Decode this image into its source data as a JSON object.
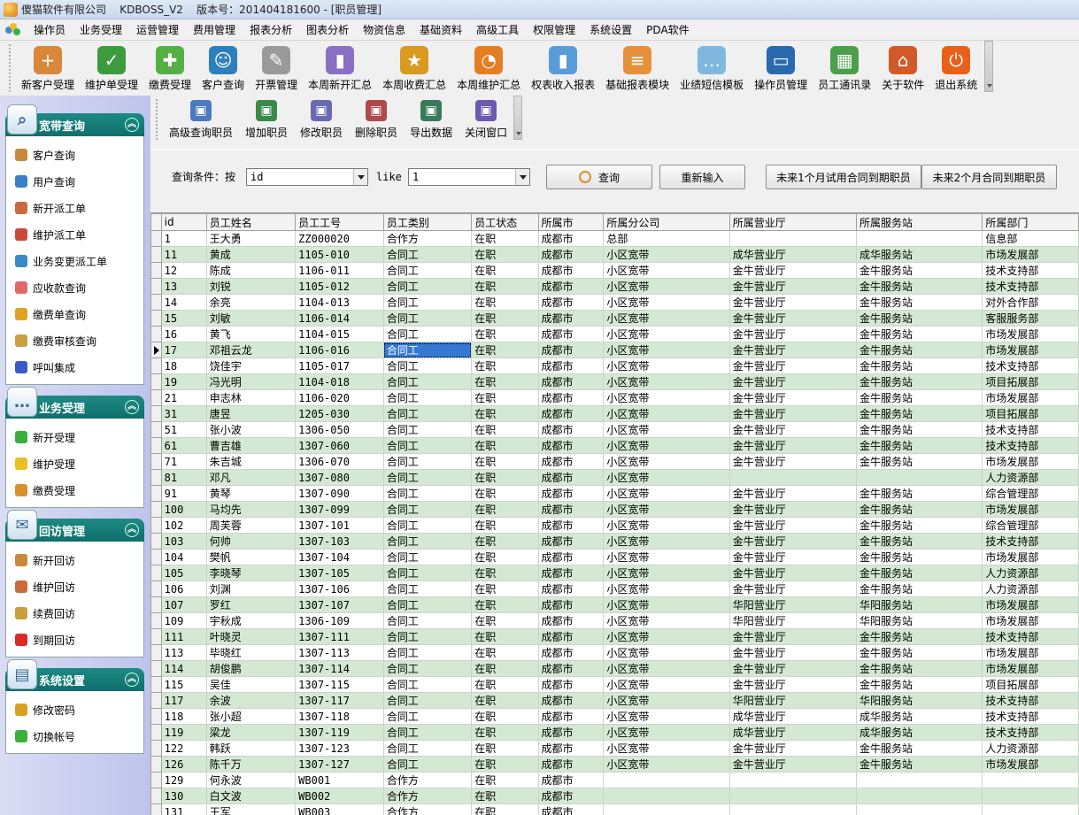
{
  "window": {
    "title": "傻猫软件有限公司    KDBOSS_V2    版本号：201404181600 - [职员管理]"
  },
  "menu": [
    "操作员",
    "业务受理",
    "运营管理",
    "费用管理",
    "报表分析",
    "图表分析",
    "物资信息",
    "基础资料",
    "高级工具",
    "权限管理",
    "系统设置",
    "PDA软件"
  ],
  "toolbar": [
    {
      "label": "新客户受理",
      "icon": "add-user-icon",
      "color": "#d9873a"
    },
    {
      "label": "维护单受理",
      "icon": "check-sheet-icon",
      "color": "#3c9b3c"
    },
    {
      "label": "缴费受理",
      "icon": "heart-plus-icon",
      "color": "#55b044"
    },
    {
      "label": "客户查询",
      "icon": "users-icon",
      "color": "#2f7fbd"
    },
    {
      "label": "开票管理",
      "icon": "invoice-icon",
      "color": "#9a9a9a"
    },
    {
      "label": "本周新开汇总",
      "icon": "bar-chart-icon",
      "color": "#8a6fc4"
    },
    {
      "label": "本周收费汇总",
      "icon": "medal-icon",
      "color": "#d99a20"
    },
    {
      "label": "本周维护汇总",
      "icon": "pie-chart-icon",
      "color": "#e57e22"
    },
    {
      "label": "权表收入报表",
      "icon": "column-chart-icon",
      "color": "#5a9cd8"
    },
    {
      "label": "基础报表模块",
      "icon": "report-chart-icon",
      "color": "#e6913a"
    },
    {
      "label": "业绩短信模板",
      "icon": "sms-icon",
      "color": "#7fb8df"
    },
    {
      "label": "操作员管理",
      "icon": "monitor-icon",
      "color": "#2869b0"
    },
    {
      "label": "员工通讯录",
      "icon": "spreadsheet-icon",
      "color": "#4aa04a"
    },
    {
      "label": "关于软件",
      "icon": "home-icon",
      "color": "#d25a2a"
    },
    {
      "label": "退出系统",
      "icon": "power-icon",
      "color": "#e8601a"
    }
  ],
  "sidebar": [
    {
      "title": "宽带查询",
      "icon": "magnifier-icon",
      "items": [
        {
          "label": "客户查询",
          "icon": "user-icon",
          "color": "#c88a3a"
        },
        {
          "label": "用户查询",
          "icon": "users-icon",
          "color": "#3a7fc8"
        },
        {
          "label": "新开派工单",
          "icon": "user-add-icon",
          "color": "#c86a3a"
        },
        {
          "label": "维护派工单",
          "icon": "user-edit-icon",
          "color": "#c84a3a"
        },
        {
          "label": "业务变更派工单",
          "icon": "user-swap-icon",
          "color": "#3a8ac8"
        },
        {
          "label": "应收款查询",
          "icon": "receivable-icon",
          "color": "#e06a6a"
        },
        {
          "label": "缴费单查询",
          "icon": "payment-icon",
          "color": "#e0a020"
        },
        {
          "label": "缴费审核查询",
          "icon": "audit-icon",
          "color": "#c8a040"
        },
        {
          "label": "呼叫集成",
          "icon": "phone-icon",
          "color": "#3a5ac8"
        }
      ]
    },
    {
      "title": "业务受理",
      "icon": "chat-icon",
      "items": [
        {
          "label": "新开受理",
          "icon": "plus-icon",
          "color": "#3ab03a"
        },
        {
          "label": "维护受理",
          "icon": "smiley-icon",
          "color": "#e8c020"
        },
        {
          "label": "缴费受理",
          "icon": "coins-icon",
          "color": "#d8902a"
        }
      ]
    },
    {
      "title": "回访管理",
      "icon": "envelope-icon",
      "items": [
        {
          "label": "新开回访",
          "icon": "user-icon",
          "color": "#c88a3a"
        },
        {
          "label": "维护回访",
          "icon": "user-edit-icon",
          "color": "#c86a3a"
        },
        {
          "label": "续费回访",
          "icon": "user-money-icon",
          "color": "#c8a03a"
        },
        {
          "label": "到期回访",
          "icon": "heart-icon",
          "color": "#d82a2a"
        }
      ]
    },
    {
      "title": "系统设置",
      "icon": "window-icon",
      "items": [
        {
          "label": "修改密码",
          "icon": "lock-icon",
          "color": "#d8a020"
        },
        {
          "label": "切换帐号",
          "icon": "switch-icon",
          "color": "#3ab03a"
        }
      ]
    }
  ],
  "subtoolbar": [
    {
      "label": "高级查询职员",
      "icon": "search-people-icon",
      "color": "#4a7ac0"
    },
    {
      "label": "增加职员",
      "icon": "add-person-icon",
      "color": "#3a8a4a"
    },
    {
      "label": "修改职员",
      "icon": "edit-person-icon",
      "color": "#6a6ab0"
    },
    {
      "label": "删除职员",
      "icon": "delete-person-icon",
      "color": "#b04a4a"
    },
    {
      "label": "导出数据",
      "icon": "export-icon",
      "color": "#3a7a5a"
    },
    {
      "label": "关闭窗口",
      "icon": "close-window-icon",
      "color": "#6a5ab0"
    }
  ],
  "query": {
    "condition_label": "查询条件：按",
    "field_value": "id",
    "operator": "like",
    "keyword_value": "1",
    "search_button": "查询",
    "reset_button": "重新输入",
    "trial_button": "未来1个月试用合同到期职员",
    "contract_button": "未来2个月合同到期职员"
  },
  "table": {
    "columns": [
      "id",
      "员工姓名",
      "员工工号",
      "员工类别",
      "员工状态",
      "所属市",
      "所属分公司",
      "所属营业厅",
      "所属服务站",
      "所属部门"
    ],
    "current_row": 7,
    "selected_cell": {
      "row": 7,
      "col": 3
    },
    "rows": [
      [
        "1",
        "王大勇",
        "ZZ000020",
        "合作方",
        "在职",
        "成都市",
        "总部",
        "",
        "",
        "信息部"
      ],
      [
        "11",
        "黄成",
        "1105-010",
        "合同工",
        "在职",
        "成都市",
        "小区宽带",
        "成华营业厅",
        "成华服务站",
        "市场发展部"
      ],
      [
        "12",
        "陈成",
        "1106-011",
        "合同工",
        "在职",
        "成都市",
        "小区宽带",
        "金牛营业厅",
        "金牛服务站",
        "技术支持部"
      ],
      [
        "13",
        "刘锐",
        "1105-012",
        "合同工",
        "在职",
        "成都市",
        "小区宽带",
        "金牛营业厅",
        "金牛服务站",
        "技术支持部"
      ],
      [
        "14",
        "余亮",
        "1104-013",
        "合同工",
        "在职",
        "成都市",
        "小区宽带",
        "金牛营业厅",
        "金牛服务站",
        "对外合作部"
      ],
      [
        "15",
        "刘敏",
        "1106-014",
        "合同工",
        "在职",
        "成都市",
        "小区宽带",
        "金牛营业厅",
        "金牛服务站",
        "客服服务部"
      ],
      [
        "16",
        "黄飞",
        "1104-015",
        "合同工",
        "在职",
        "成都市",
        "小区宽带",
        "金牛营业厅",
        "金牛服务站",
        "市场发展部"
      ],
      [
        "17",
        "邓祖云龙",
        "1106-016",
        "合同工",
        "在职",
        "成都市",
        "小区宽带",
        "金牛营业厅",
        "金牛服务站",
        "市场发展部"
      ],
      [
        "18",
        "饶佳宇",
        "1105-017",
        "合同工",
        "在职",
        "成都市",
        "小区宽带",
        "金牛营业厅",
        "金牛服务站",
        "技术支持部"
      ],
      [
        "19",
        "冯光明",
        "1104-018",
        "合同工",
        "在职",
        "成都市",
        "小区宽带",
        "金牛营业厅",
        "金牛服务站",
        "项目拓展部"
      ],
      [
        "21",
        "申志林",
        "1106-020",
        "合同工",
        "在职",
        "成都市",
        "小区宽带",
        "金牛营业厅",
        "金牛服务站",
        "市场发展部"
      ],
      [
        "31",
        "唐昱",
        "1205-030",
        "合同工",
        "在职",
        "成都市",
        "小区宽带",
        "金牛营业厅",
        "金牛服务站",
        "项目拓展部"
      ],
      [
        "51",
        "张小波",
        "1306-050",
        "合同工",
        "在职",
        "成都市",
        "小区宽带",
        "金牛营业厅",
        "金牛服务站",
        "技术支持部"
      ],
      [
        "61",
        "曹吉雄",
        "1307-060",
        "合同工",
        "在职",
        "成都市",
        "小区宽带",
        "金牛营业厅",
        "金牛服务站",
        "技术支持部"
      ],
      [
        "71",
        "朱吉城",
        "1306-070",
        "合同工",
        "在职",
        "成都市",
        "小区宽带",
        "金牛营业厅",
        "金牛服务站",
        "市场发展部"
      ],
      [
        "81",
        "邓凡",
        "1307-080",
        "合同工",
        "在职",
        "成都市",
        "小区宽带",
        "",
        "",
        "人力资源部"
      ],
      [
        "91",
        "黄琴",
        "1307-090",
        "合同工",
        "在职",
        "成都市",
        "小区宽带",
        "金牛营业厅",
        "金牛服务站",
        "综合管理部"
      ],
      [
        "100",
        "马均先",
        "1307-099",
        "合同工",
        "在职",
        "成都市",
        "小区宽带",
        "金牛营业厅",
        "金牛服务站",
        "市场发展部"
      ],
      [
        "102",
        "周芙蓉",
        "1307-101",
        "合同工",
        "在职",
        "成都市",
        "小区宽带",
        "金牛营业厅",
        "金牛服务站",
        "综合管理部"
      ],
      [
        "103",
        "何帅",
        "1307-103",
        "合同工",
        "在职",
        "成都市",
        "小区宽带",
        "金牛营业厅",
        "金牛服务站",
        "技术支持部"
      ],
      [
        "104",
        "樊帆",
        "1307-104",
        "合同工",
        "在职",
        "成都市",
        "小区宽带",
        "金牛营业厅",
        "金牛服务站",
        "市场发展部"
      ],
      [
        "105",
        "李晓琴",
        "1307-105",
        "合同工",
        "在职",
        "成都市",
        "小区宽带",
        "金牛营业厅",
        "金牛服务站",
        "人力资源部"
      ],
      [
        "106",
        "刘渊",
        "1307-106",
        "合同工",
        "在职",
        "成都市",
        "小区宽带",
        "金牛营业厅",
        "金牛服务站",
        "人力资源部"
      ],
      [
        "107",
        "罗红",
        "1307-107",
        "合同工",
        "在职",
        "成都市",
        "小区宽带",
        "华阳营业厅",
        "华阳服务站",
        "市场发展部"
      ],
      [
        "109",
        "宇秋成",
        "1306-109",
        "合同工",
        "在职",
        "成都市",
        "小区宽带",
        "华阳营业厅",
        "华阳服务站",
        "市场发展部"
      ],
      [
        "111",
        "叶晓灵",
        "1307-111",
        "合同工",
        "在职",
        "成都市",
        "小区宽带",
        "金牛营业厅",
        "金牛服务站",
        "技术支持部"
      ],
      [
        "113",
        "毕晓红",
        "1307-113",
        "合同工",
        "在职",
        "成都市",
        "小区宽带",
        "金牛营业厅",
        "金牛服务站",
        "市场发展部"
      ],
      [
        "114",
        "胡俊鹏",
        "1307-114",
        "合同工",
        "在职",
        "成都市",
        "小区宽带",
        "金牛营业厅",
        "金牛服务站",
        "市场发展部"
      ],
      [
        "115",
        "吴佳",
        "1307-115",
        "合同工",
        "在职",
        "成都市",
        "小区宽带",
        "金牛营业厅",
        "金牛服务站",
        "项目拓展部"
      ],
      [
        "117",
        "余波",
        "1307-117",
        "合同工",
        "在职",
        "成都市",
        "小区宽带",
        "华阳营业厅",
        "华阳服务站",
        "技术支持部"
      ],
      [
        "118",
        "张小超",
        "1307-118",
        "合同工",
        "在职",
        "成都市",
        "小区宽带",
        "成华营业厅",
        "成华服务站",
        "技术支持部"
      ],
      [
        "119",
        "梁龙",
        "1307-119",
        "合同工",
        "在职",
        "成都市",
        "小区宽带",
        "成华营业厅",
        "成华服务站",
        "技术支持部"
      ],
      [
        "122",
        "韩跃",
        "1307-123",
        "合同工",
        "在职",
        "成都市",
        "小区宽带",
        "金牛营业厅",
        "金牛服务站",
        "人力资源部"
      ],
      [
        "126",
        "陈千万",
        "1307-127",
        "合同工",
        "在职",
        "成都市",
        "小区宽带",
        "金牛营业厅",
        "金牛服务站",
        "市场发展部"
      ],
      [
        "129",
        "何永波",
        "WB001",
        "合作方",
        "在职",
        "成都市",
        "",
        "",
        "",
        ""
      ],
      [
        "130",
        "白文波",
        "WB002",
        "合作方",
        "在职",
        "成都市",
        "",
        "",
        "",
        ""
      ],
      [
        "131",
        "王军",
        "WB003",
        "合作方",
        "在职",
        "成都市",
        "",
        "",
        "",
        ""
      ]
    ]
  }
}
